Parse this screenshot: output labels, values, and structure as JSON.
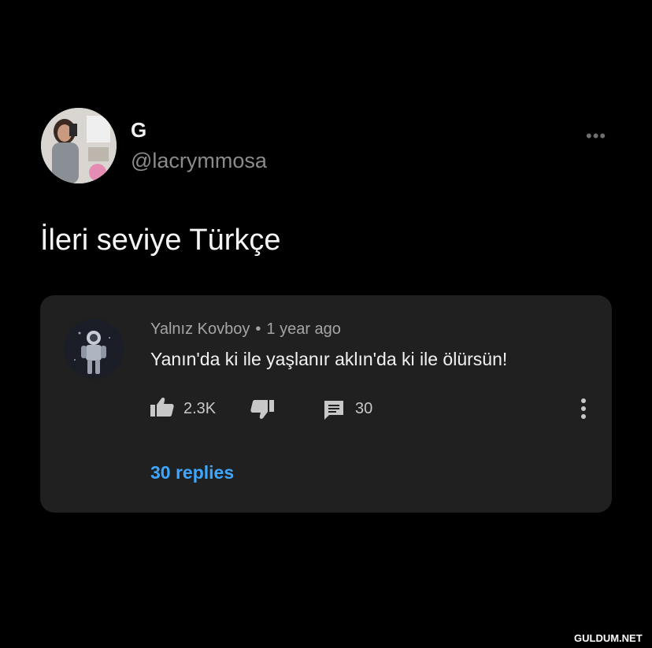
{
  "tweet": {
    "author": {
      "display_name": "G",
      "handle": "@lacrymmosa",
      "avatar_icon": "profile-photo"
    },
    "more_icon": "more-horizontal-icon",
    "more_label": "•••",
    "text": "İleri seviye Türkçe"
  },
  "comment": {
    "author": "Yalnız Kovboy",
    "separator": "•",
    "time": "1 year ago",
    "text": "Yanın'da ki ile yaşlanır aklın'da ki ile ölürsün!",
    "like_count": "2.3K",
    "reply_count": "30",
    "replies_link": "30 replies",
    "icons": {
      "like": "thumbs-up-icon",
      "dislike": "thumbs-down-icon",
      "reply": "comment-icon",
      "menu": "more-vertical-icon"
    },
    "link_color": "#3ea6ff"
  },
  "watermark": "GULDUM.NET",
  "colors": {
    "background": "#000000",
    "card": "#202020",
    "handle": "#8b8b8b"
  }
}
